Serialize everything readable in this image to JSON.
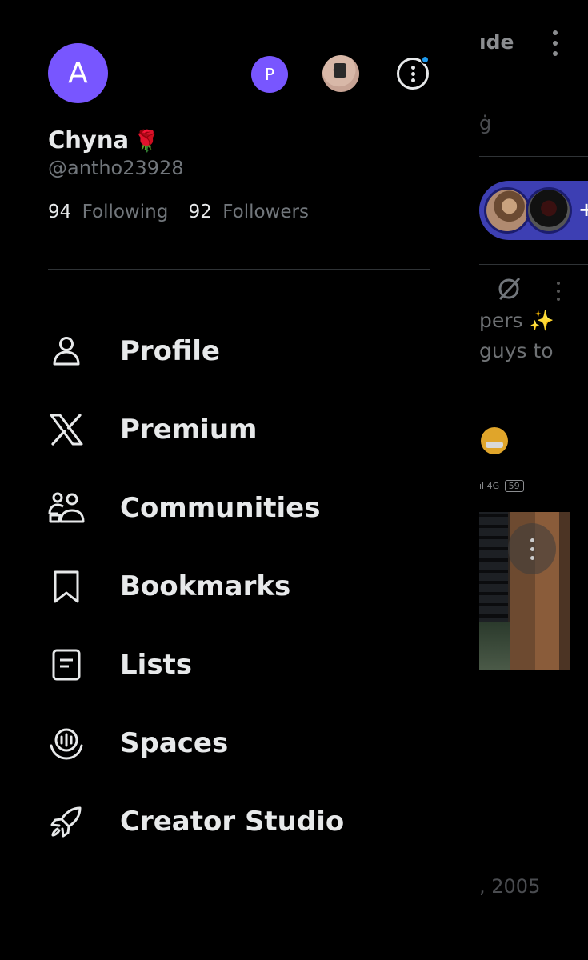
{
  "profile": {
    "avatar_letter": "A",
    "display_name": "Chyna",
    "name_emoji": "🌹",
    "handle": "@antho23928",
    "following_count": "94",
    "following_label": "Following",
    "followers_count": "92",
    "followers_label": "Followers"
  },
  "accounts": {
    "secondary_letter": "P"
  },
  "menu": [
    {
      "label": "Profile",
      "icon": "person-icon"
    },
    {
      "label": "Premium",
      "icon": "x-logo-icon"
    },
    {
      "label": "Communities",
      "icon": "communities-icon"
    },
    {
      "label": "Bookmarks",
      "icon": "bookmark-icon"
    },
    {
      "label": "Lists",
      "icon": "list-icon"
    },
    {
      "label": "Spaces",
      "icon": "spaces-icon"
    },
    {
      "label": "Creator Studio",
      "icon": "rocket-icon"
    }
  ],
  "feed": {
    "title_fragment": "ıde",
    "sub_fragment": "ġ",
    "text_line1": "pers ✨",
    "text_line2": "guys to",
    "status_fragment": "ıl 4G",
    "battery": "59",
    "date_fragment": ", 2005"
  },
  "colors": {
    "accent": "#7856ff",
    "notification_dot": "#1d9bf0",
    "spaces_bar": "#3d3fb3",
    "text_primary": "#e7e9ea",
    "text_secondary": "#71767b"
  }
}
